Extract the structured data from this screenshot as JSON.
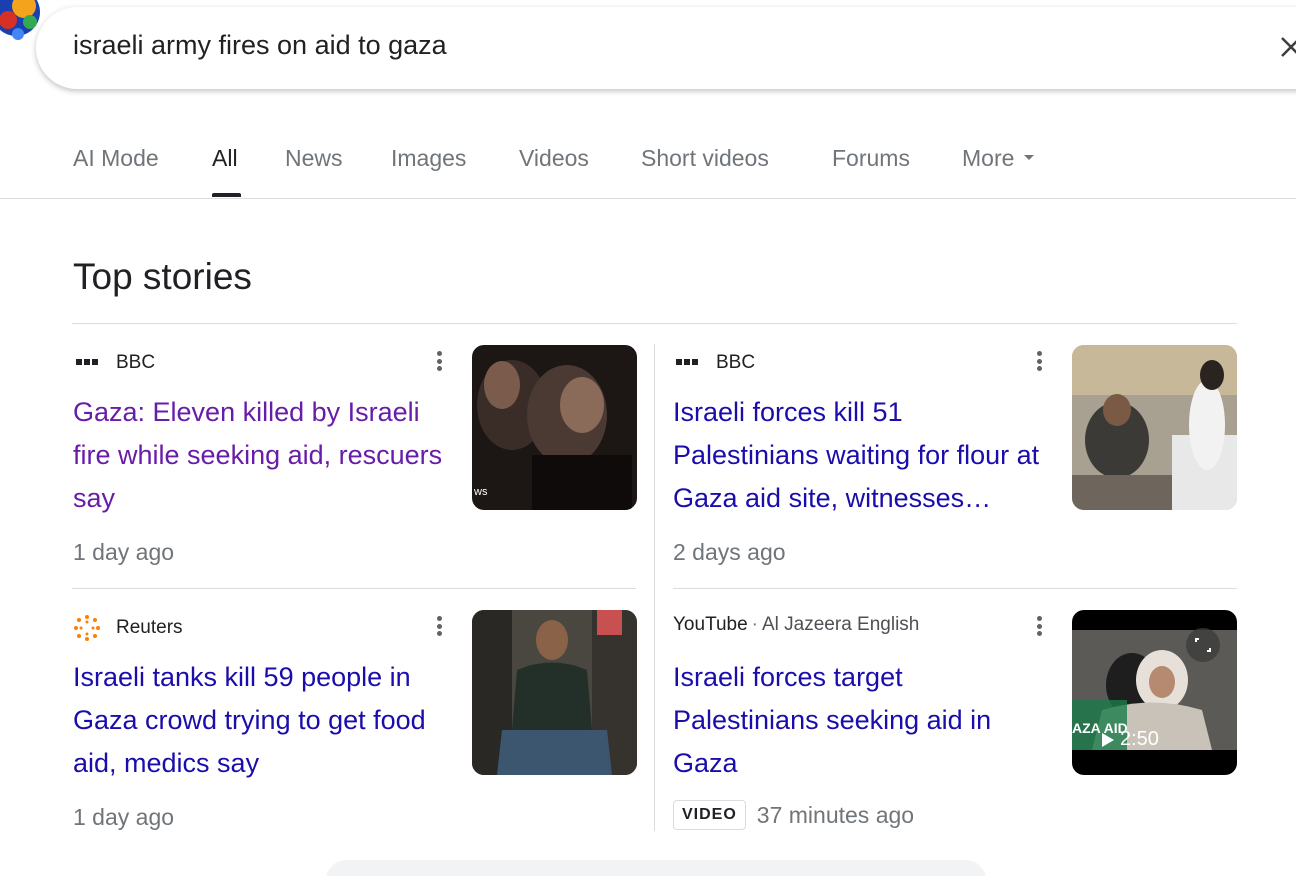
{
  "search": {
    "query": "israeli army fires on aid to gaza"
  },
  "tabs": [
    {
      "label": "AI Mode",
      "active": false
    },
    {
      "label": "All",
      "active": true
    },
    {
      "label": "News",
      "active": false
    },
    {
      "label": "Images",
      "active": false
    },
    {
      "label": "Videos",
      "active": false
    },
    {
      "label": "Short videos",
      "active": false
    },
    {
      "label": "Forums",
      "active": false
    },
    {
      "label": "More",
      "active": false
    }
  ],
  "top_stories": {
    "title": "Top stories",
    "stories": [
      {
        "source": "BBC",
        "headline": "Gaza: Eleven killed by Israeli fire while seeking aid, rescuers say",
        "time": "1 day ago",
        "visited": true
      },
      {
        "source": "BBC",
        "headline": "Israeli forces kill 51 Palestinians waiting for flour at Gaza aid site, witnesses…",
        "time": "2 days ago",
        "visited": false
      },
      {
        "source": "Reuters",
        "headline": "Israeli tanks kill 59 people in Gaza crowd trying to get food aid, medics say",
        "time": "1 day ago",
        "visited": false
      },
      {
        "source": "YouTube",
        "source_sub": "Al Jazeera English",
        "headline": "Israeli forces target Palestinians seeking aid in Gaza",
        "badge": "VIDEO",
        "time": "37 minutes ago",
        "duration": "2:50",
        "thumb_caption": "AZA AID"
      }
    ]
  },
  "colors": {
    "link": "#1a0dab",
    "visited_link": "#681da8",
    "secondary_text": "#70757a",
    "divider": "#dadce0"
  }
}
